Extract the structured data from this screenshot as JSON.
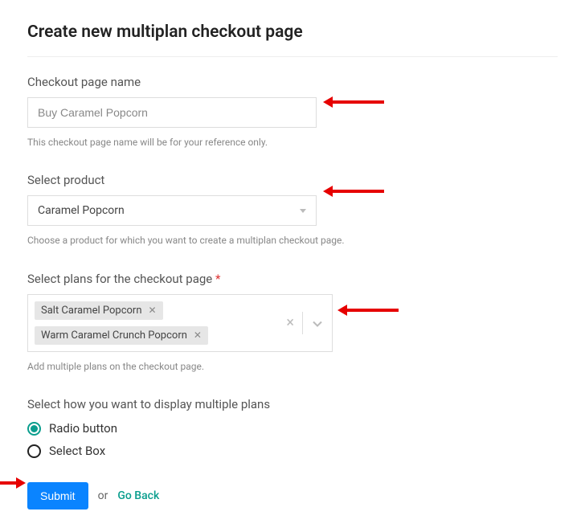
{
  "title": "Create new multiplan checkout page",
  "fields": {
    "name": {
      "label": "Checkout page name",
      "value": "Buy Caramel Popcorn",
      "hint": "This checkout page name will be for your reference only."
    },
    "product": {
      "label": "Select product",
      "selected": "Caramel Popcorn",
      "hint": "Choose a product for which you want to create a multiplan checkout page."
    },
    "plans": {
      "label": "Select plans for the checkout page",
      "tags": [
        "Salt Caramel Popcorn",
        "Warm Caramel Crunch Popcorn"
      ],
      "hint": "Add multiple plans on the checkout page."
    },
    "display": {
      "label": "Select how you want to display multiple plans",
      "options": [
        "Radio button",
        "Select Box"
      ],
      "selected": "Radio button"
    }
  },
  "actions": {
    "submit": "Submit",
    "or": "or",
    "goBack": "Go Back"
  }
}
